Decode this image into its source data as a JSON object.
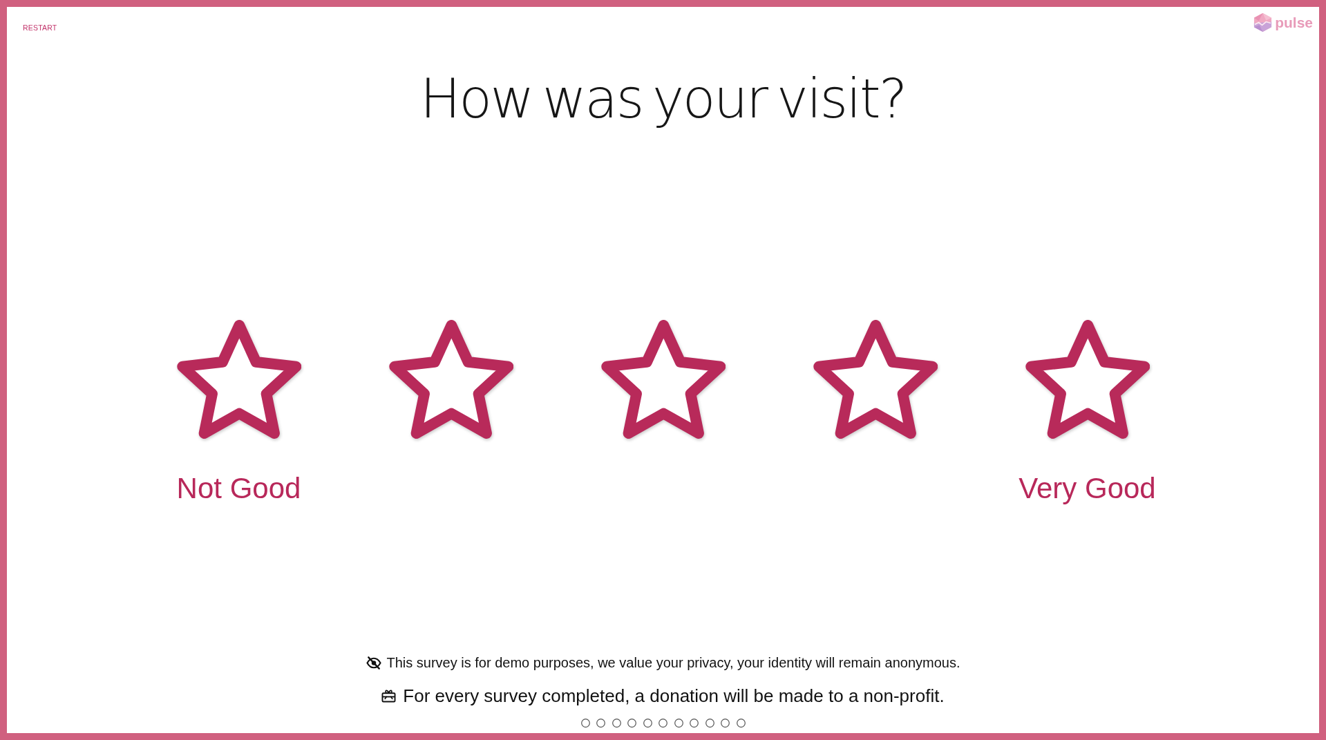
{
  "header": {
    "restart_label": "RESTART",
    "logo_text": "pulse"
  },
  "question": "How was your visit?",
  "rating": {
    "options": [
      {
        "label": "Not Good",
        "selected": false
      },
      {
        "selected": false
      },
      {
        "selected": false
      },
      {
        "selected": false
      },
      {
        "label": "Very Good",
        "selected": false
      }
    ]
  },
  "footer": {
    "privacy_note": "This survey is for demo purposes, we value your privacy, your identity will remain anonymous.",
    "donation_note": "For every survey completed, a donation will be made to a non-profit."
  },
  "progress": {
    "steps": [
      {
        "selected": false
      },
      {
        "selected": false
      },
      {
        "selected": false
      },
      {
        "selected": false
      },
      {
        "selected": false
      },
      {
        "selected": false
      },
      {
        "selected": false
      },
      {
        "selected": false
      },
      {
        "selected": false
      },
      {
        "selected": false
      },
      {
        "selected": false
      }
    ]
  }
}
